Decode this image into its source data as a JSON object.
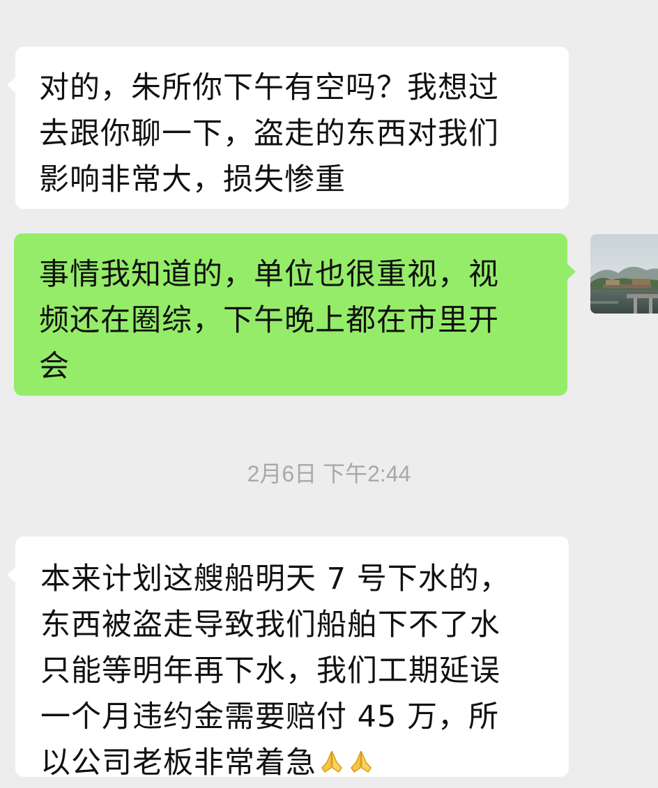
{
  "messages": [
    {
      "direction": "incoming",
      "lines": [
        "对的，朱所你下午有空吗？我想过",
        "去跟你聊一下，盗走的东西对我们",
        "影响非常大，损失惨重"
      ]
    },
    {
      "direction": "outgoing",
      "lines": [
        "事情我知道的，单位也很重视，视",
        "频还在圈综，下午晚上都在市里开",
        "会"
      ]
    },
    {
      "direction": "incoming",
      "lines": [
        "本来计划这艘船明天 7 号下水的，",
        "东西被盗走导致我们船舶下不了水",
        "只能等明年再下水，我们工期延误",
        "一个月违约金需要赔付 45 万，所",
        "以公司老板非常着急"
      ],
      "trailing_emoji": [
        "folded-hands-emoji",
        "folded-hands-emoji"
      ]
    }
  ],
  "timestamp": "2月6日 下午2:44",
  "avatar": {
    "icon": "landscape-photo-avatar"
  },
  "colors": {
    "background": "#ededed",
    "incoming_bubble": "#ffffff",
    "outgoing_bubble": "#95ec69",
    "timestamp_text": "#a8a8a8"
  }
}
